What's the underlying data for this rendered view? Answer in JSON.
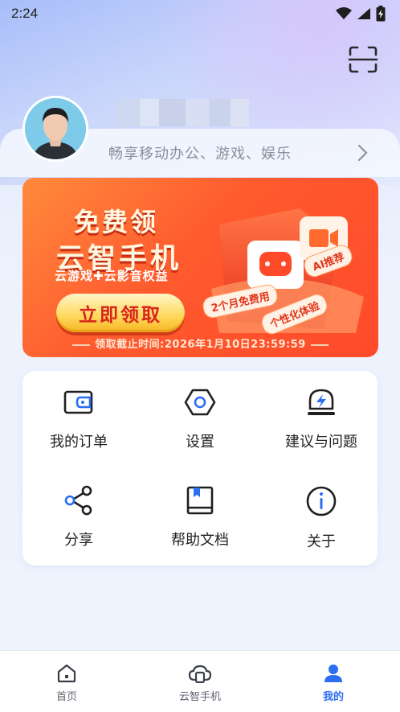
{
  "status_bar": {
    "time": "2:24",
    "icons": [
      "wifi-icon",
      "signal-icon",
      "battery-charging-icon"
    ]
  },
  "header": {
    "scan_icon": "scan-icon"
  },
  "profile": {
    "signature": "畅享移动办公、游戏、娱乐",
    "arrow_icon": "chevron-right-icon"
  },
  "banner": {
    "title_line1": "免费领",
    "title_line2": "云智手机",
    "subtitle": "云游戏✚云影音权益",
    "claim_button": "立即领取",
    "deadline": "领取截止时间:2026年1月10日23:59:59",
    "tags": [
      "AI推荐",
      "2个月免费用",
      "个性化体验"
    ],
    "colors": {
      "background": "#ff5a2e",
      "button": "#ffd75a",
      "button_text": "#d8231c"
    }
  },
  "menu": {
    "items": [
      {
        "label": "我的订单",
        "icon": "wallet-icon"
      },
      {
        "label": "设置",
        "icon": "hexagon-settings-icon"
      },
      {
        "label": "建议与问题",
        "icon": "feedback-lightning-icon"
      },
      {
        "label": "分享",
        "icon": "share-icon"
      },
      {
        "label": "帮助文档",
        "icon": "book-icon"
      },
      {
        "label": "关于",
        "icon": "info-icon"
      }
    ],
    "icon_colors": {
      "primary": "#1f1f1f",
      "accent": "#2b6ef2"
    }
  },
  "bottom_nav": {
    "items": [
      {
        "label": "首页",
        "icon": "home-icon",
        "active": false
      },
      {
        "label": "云智手机",
        "icon": "cloud-phone-icon",
        "active": false
      },
      {
        "label": "我的",
        "icon": "profile-icon",
        "active": true
      }
    ],
    "active_color": "#2b6ef2"
  }
}
